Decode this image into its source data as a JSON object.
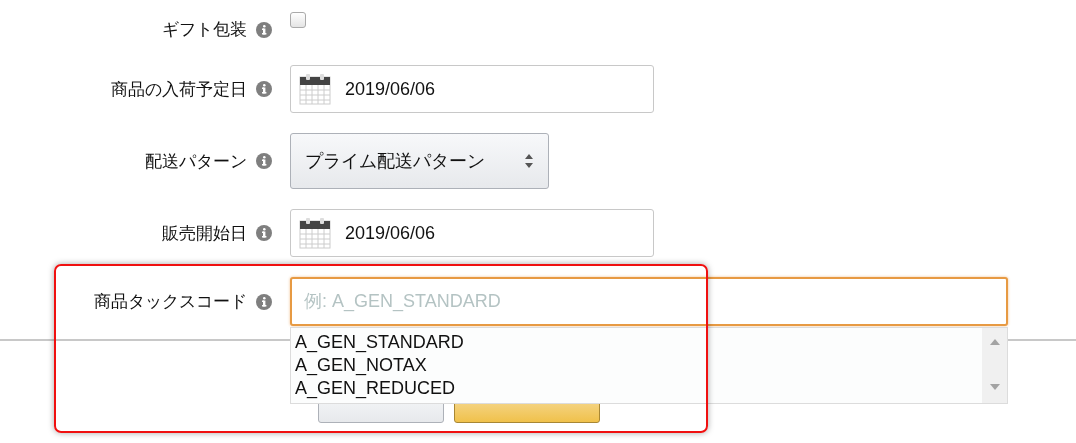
{
  "fields": [
    {
      "kind": "checkbox",
      "label": "ギフト包装",
      "checked": false
    },
    {
      "kind": "date",
      "label": "商品の入荷予定日",
      "value": "2019/06/06"
    },
    {
      "kind": "select",
      "label": "配送パターン",
      "value": "プライム配送パターン"
    },
    {
      "kind": "date",
      "label": "販売開始日",
      "value": "2019/06/06"
    },
    {
      "kind": "text",
      "label": "商品タックスコード",
      "placeholder": "例: A_GEN_STANDARD",
      "focused": true,
      "highlighted": true,
      "suggestions": [
        "A_GEN_STANDARD",
        "A_GEN_NOTAX",
        "A_GEN_REDUCED"
      ]
    }
  ]
}
